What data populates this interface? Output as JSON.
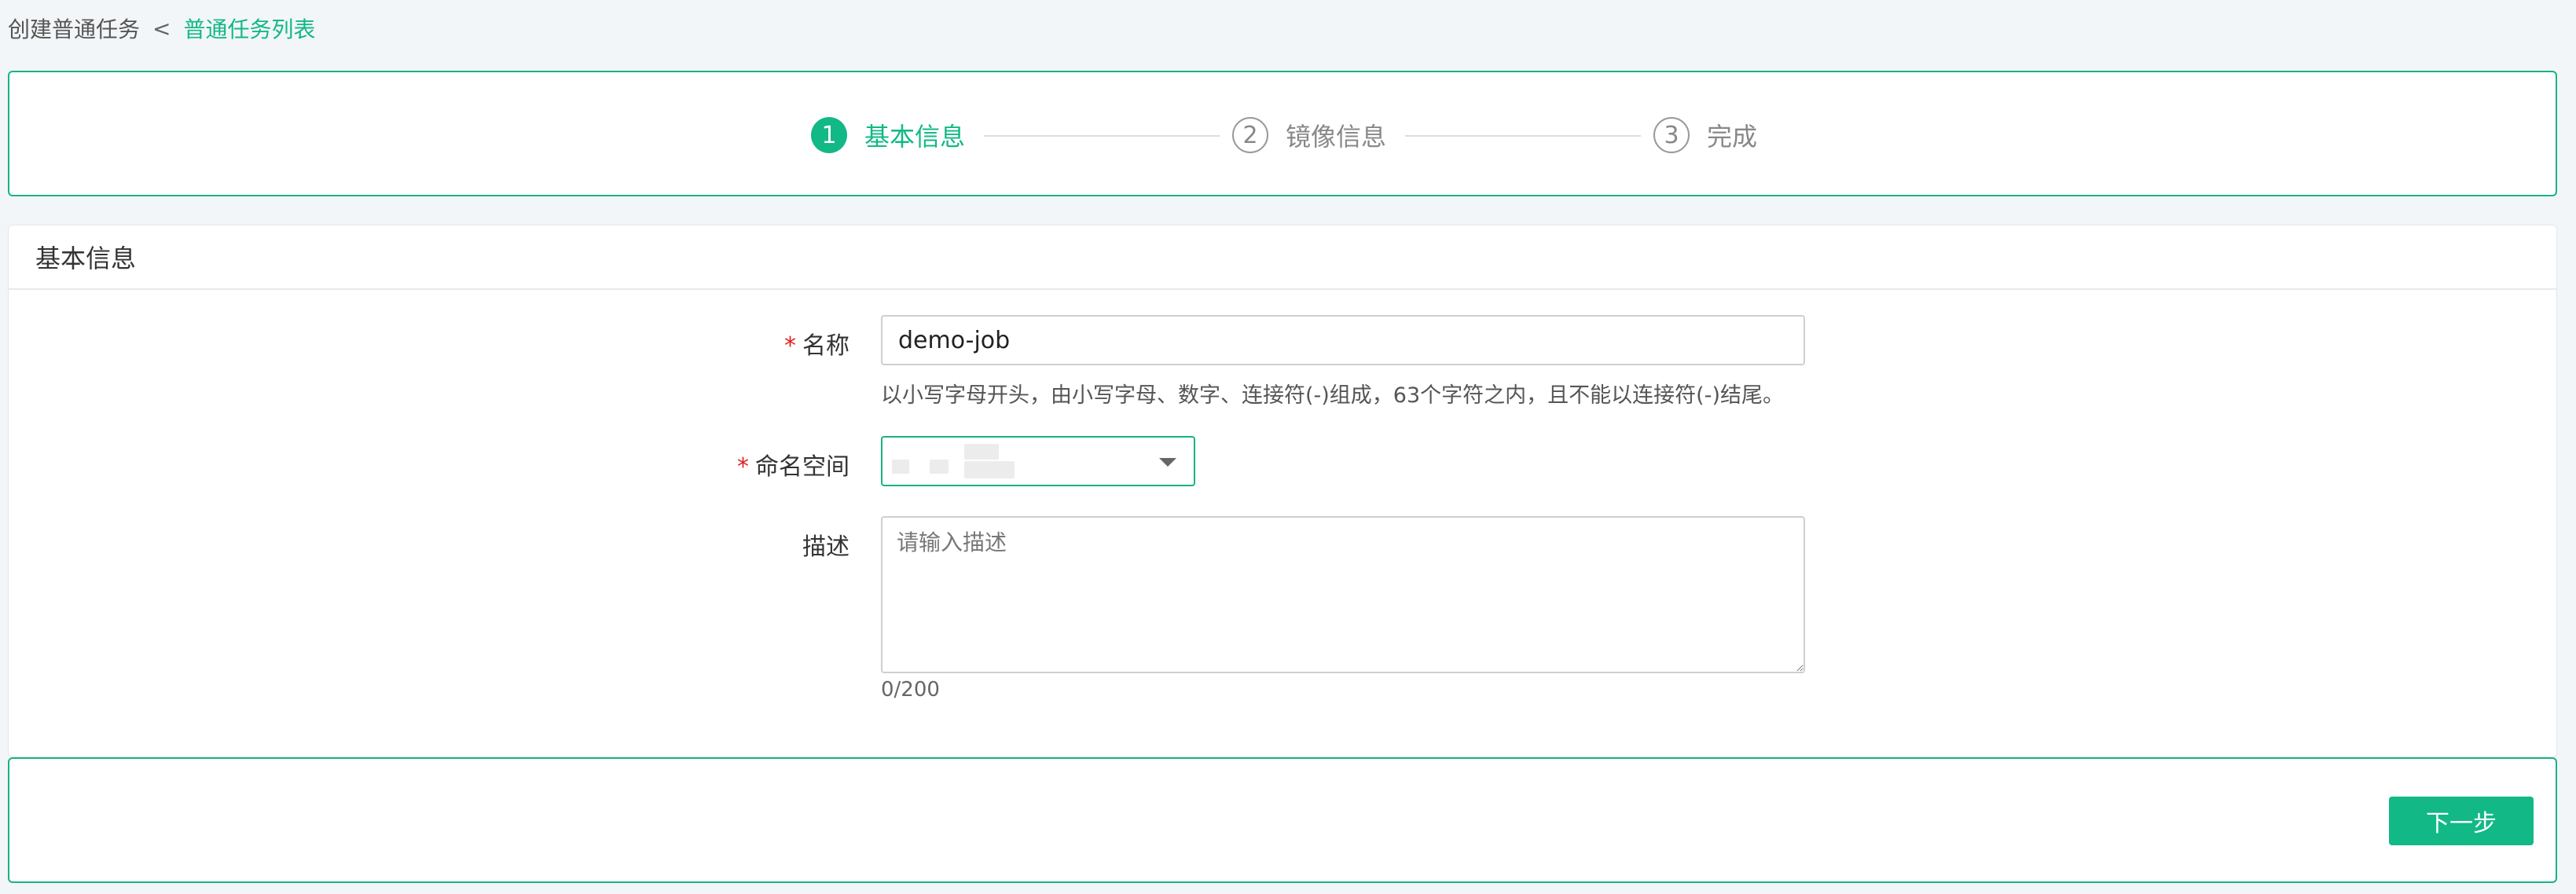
{
  "breadcrumb": {
    "current": "创建普通任务",
    "separator": "<",
    "parent_link": "普通任务列表"
  },
  "steps": [
    {
      "number": "1",
      "label": "基本信息",
      "state": "active"
    },
    {
      "number": "2",
      "label": "镜像信息",
      "state": "inactive"
    },
    {
      "number": "3",
      "label": "完成",
      "state": "inactive"
    }
  ],
  "form": {
    "section_title": "基本信息",
    "required_mark": "*",
    "name": {
      "label": "名称",
      "value": "demo-job",
      "hint": "以小写字母开头，由小写字母、数字、连接符(-)组成，63个字符之内，且不能以连接符(-)结尾。"
    },
    "namespace": {
      "label": "命名空间",
      "value": ""
    },
    "description": {
      "label": "描述",
      "placeholder": "请输入描述",
      "value": "",
      "counter": "0/200"
    }
  },
  "footer": {
    "next_label": "下一步"
  },
  "colors": {
    "accent": "#12b886",
    "required": "#e02020",
    "background": "#f3f6f9"
  }
}
